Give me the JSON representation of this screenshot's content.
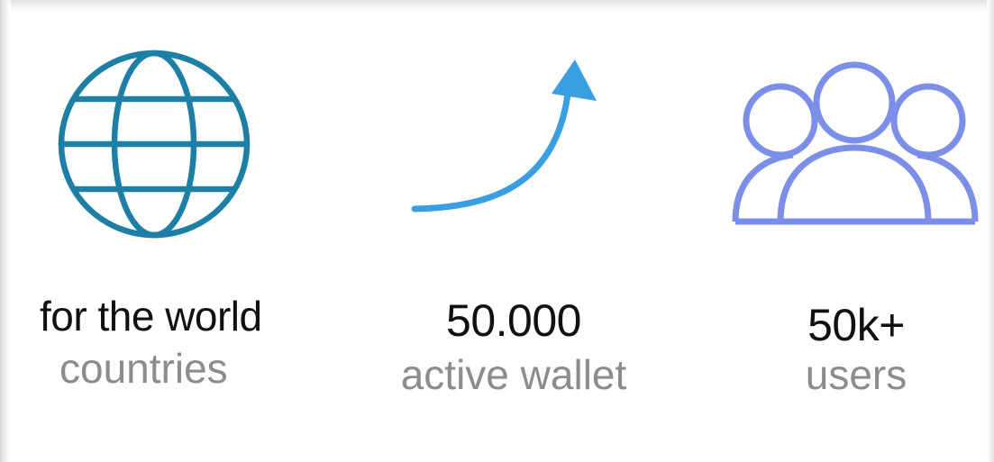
{
  "stats": [
    {
      "icon": "globe-icon",
      "value": "for the world",
      "label": "countries",
      "color": "#1d7fa6"
    },
    {
      "icon": "trend-arrow-icon",
      "value": "50.000",
      "label": "active wallet",
      "color": "#3a9fe0"
    },
    {
      "icon": "users-group-icon",
      "value": "50k+",
      "label": "users",
      "color": "#7b8ee8"
    }
  ],
  "colors": {
    "value_text": "#111111",
    "label_text": "#8c8c8c",
    "background": "#ffffff"
  }
}
